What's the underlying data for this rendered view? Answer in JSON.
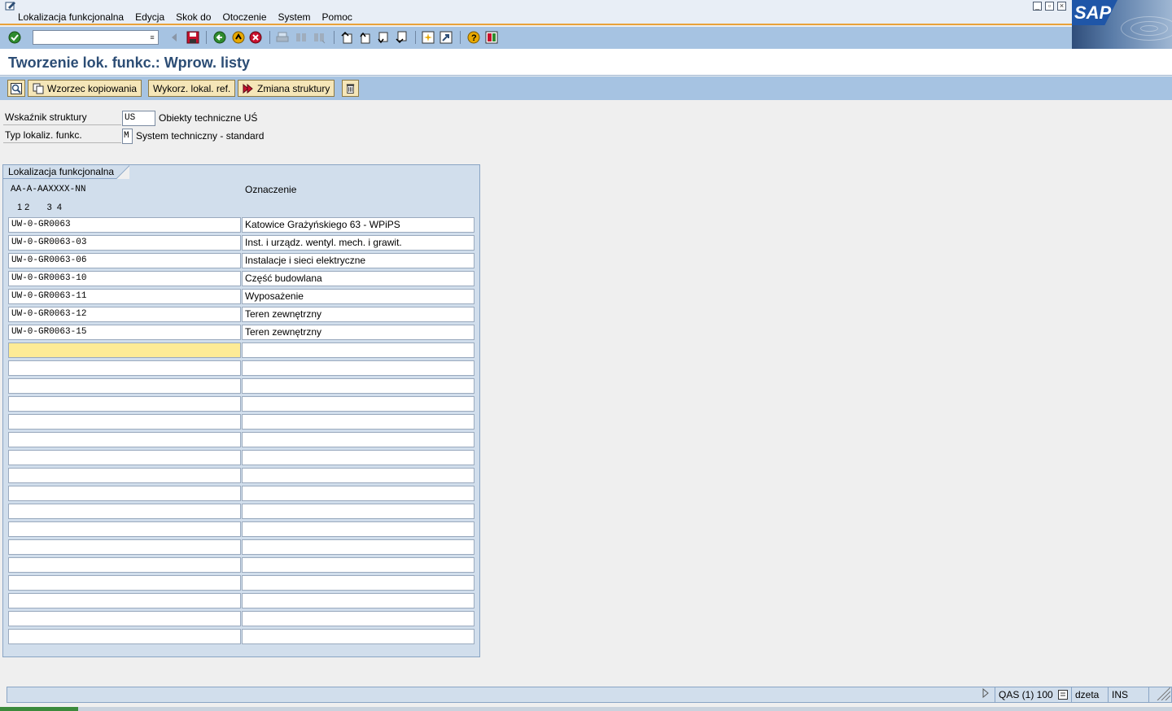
{
  "menu": {
    "items": [
      {
        "label": "Lokalizacja funkcjonalna"
      },
      {
        "label": "Edycja"
      },
      {
        "label": "Skok do"
      },
      {
        "label": "Otoczenie"
      },
      {
        "label": "System"
      },
      {
        "label": "Pomoc"
      }
    ],
    "logo_text": "SAP"
  },
  "toolbar": {
    "command_value": ""
  },
  "page": {
    "title": "Tworzenie lok. funkc.: Wprow. listy"
  },
  "app_toolbar": {
    "copy_template_label": "Wzorzec kopiowania",
    "use_ref_label": "Wykorz. lokal. ref.",
    "change_structure_label": "Zmiana struktury"
  },
  "form": {
    "structure_indicator": {
      "label": "Wskaźnik struktury",
      "value": "US",
      "description": "Obiekty techniczne UŚ"
    },
    "fl_type": {
      "label": "Typ lokaliz. funkc.",
      "value": "M",
      "description": "System techniczny - standard"
    }
  },
  "group": {
    "title": "Lokalizacja funkcjonalna",
    "mask": "AA-A-AAXXXX-NN",
    "levels": "1 2       3  4",
    "col_designation": "Oznaczenie",
    "rows": [
      {
        "fl": "UW-0-GR0063",
        "desc": "Katowice Grażyńskiego 63 - WPiPS"
      },
      {
        "fl": "UW-0-GR0063-03",
        "desc": "Inst. i urządz. wentyl. mech. i grawit."
      },
      {
        "fl": "UW-0-GR0063-06",
        "desc": "Instalacje i sieci elektryczne"
      },
      {
        "fl": "UW-0-GR0063-10",
        "desc": "Część budowlana"
      },
      {
        "fl": "UW-0-GR0063-11",
        "desc": "Wyposażenie"
      },
      {
        "fl": "UW-0-GR0063-12",
        "desc": "Teren zewnętrzny"
      },
      {
        "fl": "UW-0-GR0063-15",
        "desc": "Teren zewnętrzny"
      },
      {
        "fl": "",
        "desc": ""
      },
      {
        "fl": "",
        "desc": ""
      },
      {
        "fl": "",
        "desc": ""
      },
      {
        "fl": "",
        "desc": ""
      },
      {
        "fl": "",
        "desc": ""
      },
      {
        "fl": "",
        "desc": ""
      },
      {
        "fl": "",
        "desc": ""
      },
      {
        "fl": "",
        "desc": ""
      },
      {
        "fl": "",
        "desc": ""
      },
      {
        "fl": "",
        "desc": ""
      },
      {
        "fl": "",
        "desc": ""
      },
      {
        "fl": "",
        "desc": ""
      },
      {
        "fl": "",
        "desc": ""
      },
      {
        "fl": "",
        "desc": ""
      },
      {
        "fl": "",
        "desc": ""
      },
      {
        "fl": "",
        "desc": ""
      },
      {
        "fl": "",
        "desc": ""
      }
    ]
  },
  "status": {
    "system": "QAS (1) 100",
    "user": "dzeta",
    "mode": "INS"
  }
}
